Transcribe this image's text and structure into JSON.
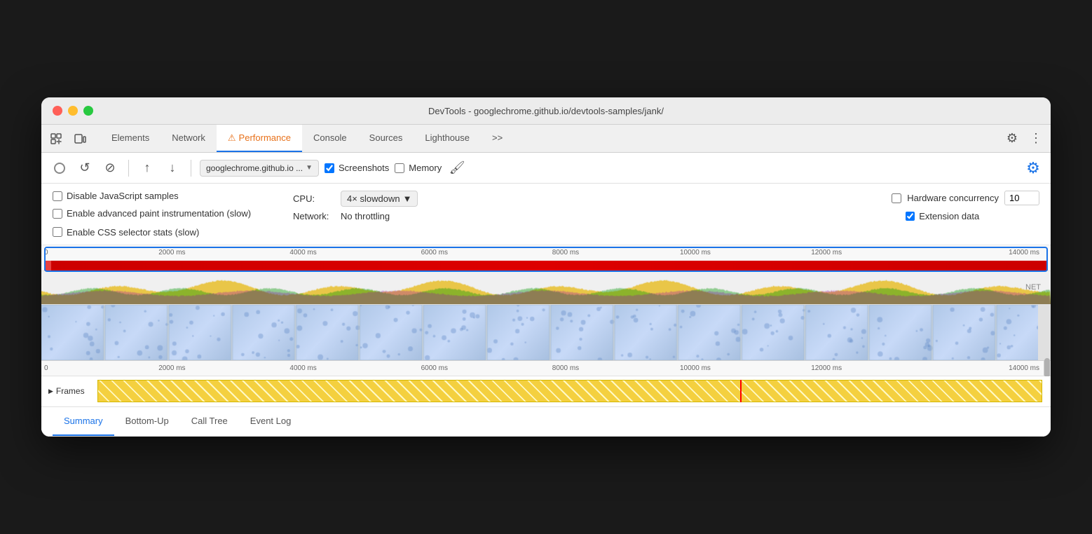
{
  "window": {
    "title": "DevTools - googlechrome.github.io/devtools-samples/jank/"
  },
  "tabs": {
    "items": [
      {
        "label": "Elements",
        "active": false
      },
      {
        "label": "Network",
        "active": false
      },
      {
        "label": "Performance",
        "active": true,
        "warning": true
      },
      {
        "label": "Console",
        "active": false
      },
      {
        "label": "Sources",
        "active": false
      },
      {
        "label": "Lighthouse",
        "active": false
      },
      {
        "label": ">>",
        "active": false
      }
    ]
  },
  "toolbar": {
    "url": "googlechrome.github.io ...",
    "screenshots_label": "Screenshots",
    "memory_label": "Memory"
  },
  "settings": {
    "disable_js_samples": "Disable JavaScript samples",
    "enable_paint": "Enable advanced paint instrumentation (slow)",
    "enable_css": "Enable CSS selector stats (slow)",
    "cpu_label": "CPU:",
    "cpu_value": "4× slowdown",
    "network_label": "Network:",
    "network_value": "No throttling",
    "hw_concurrency_label": "Hardware concurrency",
    "hw_concurrency_value": "10",
    "ext_data_label": "Extension data"
  },
  "ruler": {
    "ticks": [
      "2000 ms",
      "4000 ms",
      "6000 ms",
      "8000 ms",
      "10000 ms",
      "12000 ms",
      "14000 ms"
    ]
  },
  "ruler2": {
    "ticks": [
      "2000 ms",
      "4000 ms",
      "6000 ms",
      "8000 ms",
      "10000 ms",
      "12000 ms",
      "14000 ms"
    ]
  },
  "net_label": "NET",
  "frames": {
    "label": "Frames",
    "red_position": "68%"
  },
  "bottom_tabs": {
    "items": [
      {
        "label": "Summary",
        "active": true
      },
      {
        "label": "Bottom-Up",
        "active": false
      },
      {
        "label": "Call Tree",
        "active": false
      },
      {
        "label": "Event Log",
        "active": false
      }
    ]
  },
  "icons": {
    "record": "●",
    "reload": "↺",
    "clear": "⊘",
    "upload": "↑",
    "download": "↓",
    "settings": "⚙",
    "more": "⋮",
    "gear_blue": "⚙",
    "frames_triangle": "▶"
  }
}
